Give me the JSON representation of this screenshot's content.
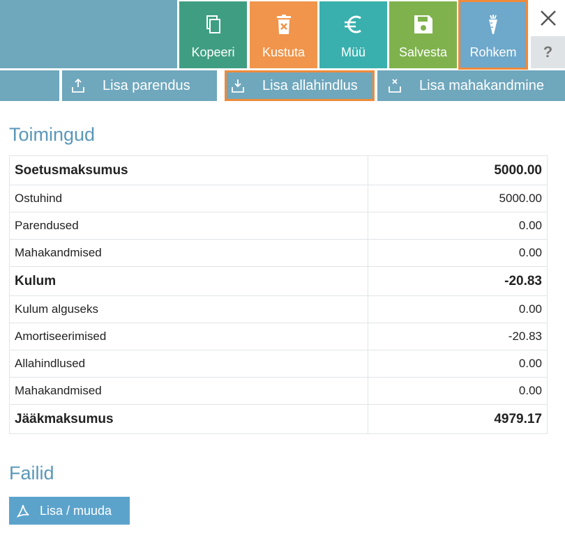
{
  "toolbar": {
    "copy_label": "Kopeeri",
    "delete_label": "Kustuta",
    "sell_label": "Müü",
    "save_label": "Salvesta",
    "more_label": "Rohkem",
    "help_label": "?"
  },
  "actions": {
    "add_improvement": "Lisa parendus",
    "add_writedown": "Lisa allahindlus",
    "add_writeoff": "Lisa mahakandmine"
  },
  "operations": {
    "title": "Toimingud",
    "rows": [
      {
        "label": "Soetusmaksumus",
        "value": "5000.00",
        "bold": true
      },
      {
        "label": "Ostuhind",
        "value": "5000.00",
        "bold": false
      },
      {
        "label": "Parendused",
        "value": "0.00",
        "bold": false
      },
      {
        "label": "Mahakandmised",
        "value": "0.00",
        "bold": false
      },
      {
        "label": "Kulum",
        "value": "-20.83",
        "bold": true
      },
      {
        "label": "Kulum alguseks",
        "value": "0.00",
        "bold": false
      },
      {
        "label": "Amortiseerimised",
        "value": "-20.83",
        "bold": false
      },
      {
        "label": "Allahindlused",
        "value": "0.00",
        "bold": false
      },
      {
        "label": "Mahakandmised",
        "value": "0.00",
        "bold": false
      },
      {
        "label": "Jääkmaksumus",
        "value": "4979.17",
        "bold": true
      }
    ]
  },
  "files": {
    "title": "Failid",
    "add_label": "Lisa / muuda"
  },
  "colors": {
    "copy": "#3f9e82",
    "delete": "#f0954b",
    "sell": "#39b0ad",
    "save": "#7fb24d",
    "more": "#6ea8cb",
    "highlight": "#ef8a3a",
    "toolbar_blue": "#6fa7bd"
  }
}
